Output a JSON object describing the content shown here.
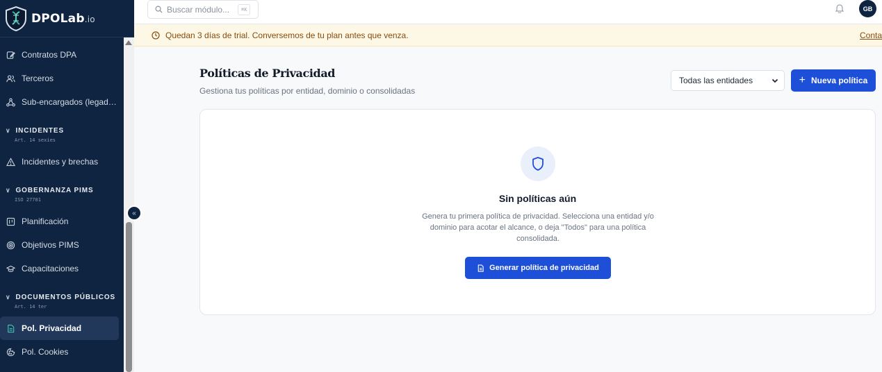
{
  "brand": {
    "name": "DPOLab",
    "suffix": ".io"
  },
  "sidebar": {
    "items_top": [
      {
        "label": "Contratos DPA",
        "icon": "edit-document-icon"
      },
      {
        "label": "Terceros",
        "icon": "users-icon"
      },
      {
        "label": "Sub-encargados (legad…",
        "icon": "network-icon"
      }
    ],
    "sections": [
      {
        "title": "INCIDENTES",
        "sub": "Art. 14 sexies",
        "items": [
          {
            "label": "Incidentes y brechas",
            "icon": "warning-icon"
          }
        ]
      },
      {
        "title": "GOBERNANZA PIMS",
        "sub": "ISO 27701",
        "items": [
          {
            "label": "Planificación",
            "icon": "board-icon"
          },
          {
            "label": "Objetivos PIMS",
            "icon": "target-icon"
          },
          {
            "label": "Capacitaciones",
            "icon": "graduation-cap-icon"
          }
        ]
      },
      {
        "title": "DOCUMENTOS PÚBLICOS",
        "sub": "Art. 14 ter",
        "items": [
          {
            "label": "Pol. Privacidad",
            "icon": "document-icon",
            "active": true
          },
          {
            "label": "Pol. Cookies",
            "icon": "cookie-icon"
          }
        ]
      }
    ],
    "collapse_glyph": "«"
  },
  "topbar": {
    "search_placeholder": "Buscar módulo...",
    "shortcut": "⌘K",
    "avatar_initials": "GB"
  },
  "banner": {
    "text": "Quedan 3 días de trial. Conversemos de tu plan antes que venza.",
    "link": "Conta"
  },
  "main": {
    "title": "Políticas de Privacidad",
    "subtitle": "Gestiona tus políticas por entidad, dominio o consolidadas",
    "entity_filter": "Todas las entidades",
    "new_button": "Nueva política",
    "empty": {
      "title": "Sin políticas aún",
      "description": "Genera tu primera política de privacidad. Selecciona una entidad y/o dominio para acotar el alcance, o deja \"Todos\" para una política consolidada.",
      "action": "Generar política de privacidad"
    }
  },
  "colors": {
    "sidebar_bg": "#0f2440",
    "primary": "#1d4fd8",
    "banner_bg": "#fdf8e6",
    "banner_text": "#8a4b0c"
  }
}
